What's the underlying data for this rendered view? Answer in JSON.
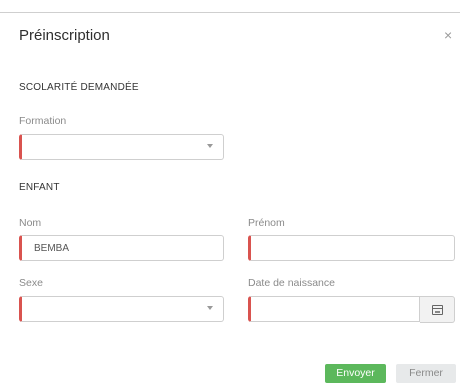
{
  "modal": {
    "title": "Préinscription",
    "close_symbol": "×"
  },
  "sections": {
    "scolarite": "SCOLARITÉ DEMANDÉE",
    "enfant": "ENFANT"
  },
  "fields": {
    "formation": {
      "label": "Formation",
      "value": ""
    },
    "nom": {
      "label": "Nom",
      "value": "BEMBA"
    },
    "prenom": {
      "label": "Prénom",
      "value": ""
    },
    "sexe": {
      "label": "Sexe",
      "value": ""
    },
    "date_naissance": {
      "label": "Date de naissance",
      "value": ""
    }
  },
  "buttons": {
    "send": "Envoyer",
    "close": "Fermer"
  },
  "icons": {
    "close": "close-icon",
    "calendar": "calendar-icon",
    "dropdown": "chevron-down-icon"
  },
  "colors": {
    "required_marker": "#d9534f",
    "primary_button": "#5cb85c",
    "secondary_button": "#e7e9ea"
  }
}
